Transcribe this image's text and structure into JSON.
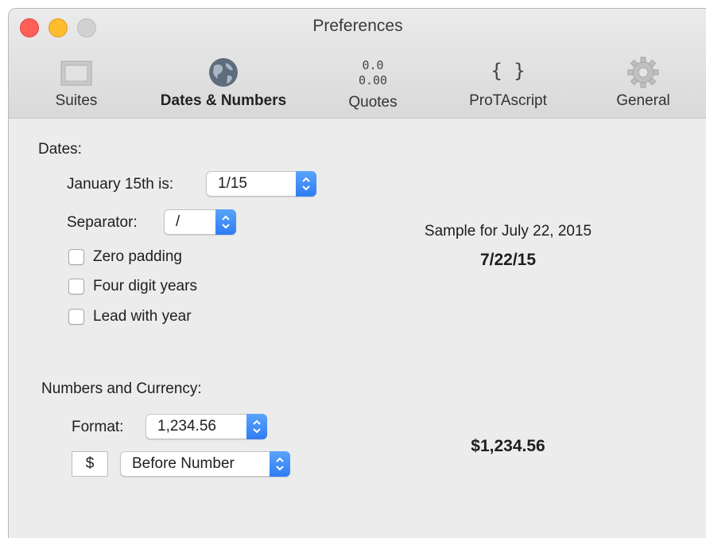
{
  "window": {
    "title": "Preferences"
  },
  "toolbar": {
    "items": [
      {
        "label": "Suites",
        "icon": "suites-icon"
      },
      {
        "label": "Dates & Numbers",
        "icon": "globe-icon",
        "active": true
      },
      {
        "label": "Quotes",
        "icon": "quotes-icon",
        "icon_lines": [
          "0.0",
          "0.00"
        ]
      },
      {
        "label": "ProTAscript",
        "icon": "braces-icon",
        "icon_text": "{ }"
      },
      {
        "label": "General",
        "icon": "gear-icon"
      }
    ]
  },
  "dates": {
    "heading": "Dates:",
    "january_label": "January 15th is:",
    "january_value": "1/15",
    "separator_label": "Separator:",
    "separator_value": "/",
    "checkboxes": [
      {
        "label": "Zero padding",
        "checked": false
      },
      {
        "label": "Four digit years",
        "checked": false
      },
      {
        "label": "Lead with year",
        "checked": false
      }
    ],
    "sample_caption": "Sample for July 22, 2015",
    "sample_value": "7/22/15"
  },
  "numbers": {
    "heading": "Numbers and Currency:",
    "format_label": "Format:",
    "format_value": "1,234.56",
    "currency_symbol": "$",
    "position_value": "Before Number",
    "sample_value": "$1,234.56"
  },
  "colors": {
    "accent": "#3b82f6",
    "close": "#fe5f57",
    "minimize": "#febc2e",
    "zoom_disabled": "#d1d1d1"
  }
}
